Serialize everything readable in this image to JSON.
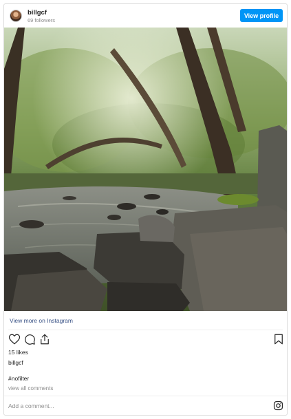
{
  "header": {
    "username": "billgcf",
    "followers": "69 followers",
    "view_profile_label": "View profile"
  },
  "photo": {
    "description_icon": "river-forest-photo"
  },
  "links": {
    "view_more": "View more on Instagram"
  },
  "actions": {
    "like_icon": "heart-icon",
    "comment_icon": "comment-icon",
    "share_icon": "share-icon",
    "save_icon": "bookmark-icon"
  },
  "post": {
    "likes": "15 likes",
    "caption_user": "billgcf",
    "hashtag": "#nofilter",
    "view_all_comments": "view all comments"
  },
  "comment": {
    "placeholder": "Add a comment..."
  },
  "colors": {
    "accent": "#0095f6",
    "link": "#385185",
    "muted": "#8e8e8e",
    "border": "#dbdbdb"
  }
}
